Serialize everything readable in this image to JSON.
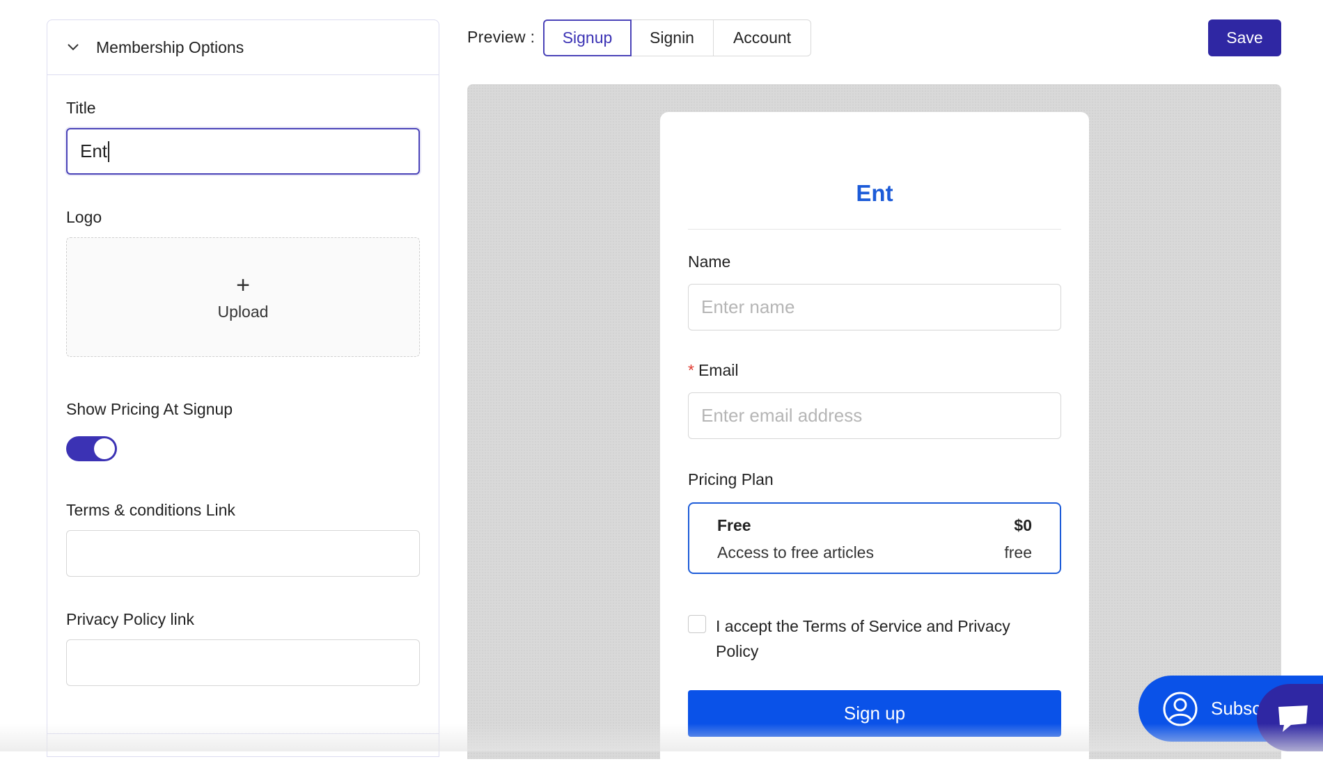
{
  "panel": {
    "header": "Membership Options",
    "title_label": "Title",
    "title_value": "Ent",
    "logo_label": "Logo",
    "upload_label": "Upload",
    "show_pricing_label": "Show Pricing At Signup",
    "show_pricing_enabled": true,
    "terms_label": "Terms & conditions Link",
    "terms_value": "",
    "privacy_label": "Privacy Policy link",
    "privacy_value": ""
  },
  "toolbar": {
    "preview_label": "Preview :",
    "tabs": [
      "Signup",
      "Signin",
      "Account"
    ],
    "active_tab": "Signup",
    "save_label": "Save"
  },
  "preview_card": {
    "title": "Ent",
    "name_label": "Name",
    "name_placeholder": "Enter name",
    "email_required_mark": "*",
    "email_label": "Email",
    "email_placeholder": "Enter email address",
    "pricing_label": "Pricing Plan",
    "plan": {
      "name": "Free",
      "price": "$0",
      "description": "Access to free articles",
      "period": "free"
    },
    "accept_text": "I accept the Terms of Service and Privacy Policy",
    "signup_label": "Sign up"
  },
  "widget": {
    "subscribe_label": "Subsc"
  },
  "colors": {
    "accent": "#3b32b4",
    "save": "#2f27a3",
    "preview_blue": "#0a52e8",
    "title_blue": "#1c5bd8"
  }
}
